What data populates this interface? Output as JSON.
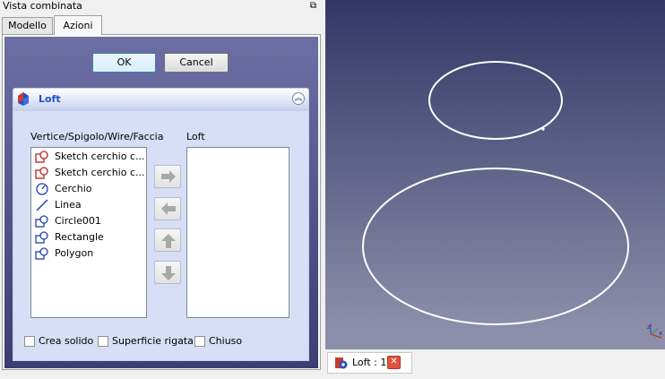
{
  "panel": {
    "title": "Vista combinata",
    "float_icon": "⧉"
  },
  "tabs": [
    {
      "label": "Modello"
    },
    {
      "label": "Azioni"
    }
  ],
  "buttons": {
    "ok": "OK",
    "cancel": "Cancel"
  },
  "loft": {
    "title": "Loft",
    "collapse_icon": "︽",
    "left_label": "Vertice/Spigolo/Wire/Faccia",
    "right_label": "Loft",
    "items": [
      {
        "label": "Sketch cerchio c...",
        "icon": "sketch-icon"
      },
      {
        "label": "Sketch cerchio c...",
        "icon": "sketch-icon"
      },
      {
        "label": "Cerchio",
        "icon": "circle-icon"
      },
      {
        "label": "Linea",
        "icon": "line-icon"
      },
      {
        "label": "Circle001",
        "icon": "shape-icon"
      },
      {
        "label": "Rectangle",
        "icon": "shape-icon"
      },
      {
        "label": "Polygon",
        "icon": "shape-icon"
      }
    ],
    "options": {
      "solid": "Crea solido",
      "ruled": "Superficie rigata",
      "closed": "Chiuso"
    }
  },
  "document_tab": {
    "label": "Loft : 1",
    "close": "✕"
  },
  "colors": {
    "accent": "#2250c8",
    "view_top": "#333766",
    "view_bottom": "#8d8faa"
  }
}
